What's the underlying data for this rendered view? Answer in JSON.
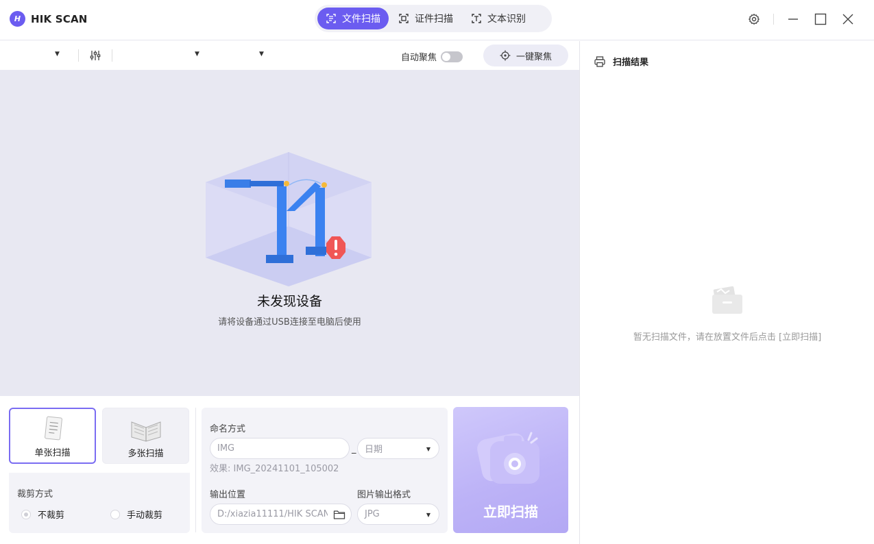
{
  "app": {
    "logo_mark": "H",
    "name": "HIK SCAN"
  },
  "mode_tabs": [
    {
      "label": "文件扫描",
      "icon": "document-scan-icon",
      "active": true
    },
    {
      "label": "证件扫描",
      "icon": "id-scan-icon",
      "active": false
    },
    {
      "label": "文本识别",
      "icon": "text-recognition-icon",
      "active": false
    }
  ],
  "toolbar": {
    "auto_focus_label": "自动聚焦",
    "auto_focus_on": false,
    "focus_button_label": "一键聚焦"
  },
  "preview": {
    "title": "未发现设备",
    "subtitle": "请将设备通过USB连接至电脑后使用"
  },
  "scan_modes": {
    "single": {
      "label": "单张扫描",
      "selected": true
    },
    "multi": {
      "label": "多张扫描",
      "selected": false
    }
  },
  "crop": {
    "title": "裁剪方式",
    "options": [
      {
        "label": "不裁剪",
        "checked": true
      },
      {
        "label": "手动裁剪",
        "checked": false
      }
    ]
  },
  "naming": {
    "label": "命名方式",
    "prefix_placeholder": "IMG",
    "separator": "_",
    "suffix_value": "日期",
    "effect": "效果: IMG_20241101_105002"
  },
  "output": {
    "location_label": "输出位置",
    "location_value": "D:/xiazia11111/HIK SCAN",
    "format_label": "图片输出格式",
    "format_value": "JPG"
  },
  "scan_button": {
    "label": "立即扫描"
  },
  "results": {
    "title": "扫描结果",
    "empty_text": "暂无扫描文件，请在放置文件后点击 [立即扫描]"
  },
  "colors": {
    "accent": "#6b5cf0",
    "preview_bg": "#e8e8f2",
    "scan_button": "#bdb3f7"
  }
}
